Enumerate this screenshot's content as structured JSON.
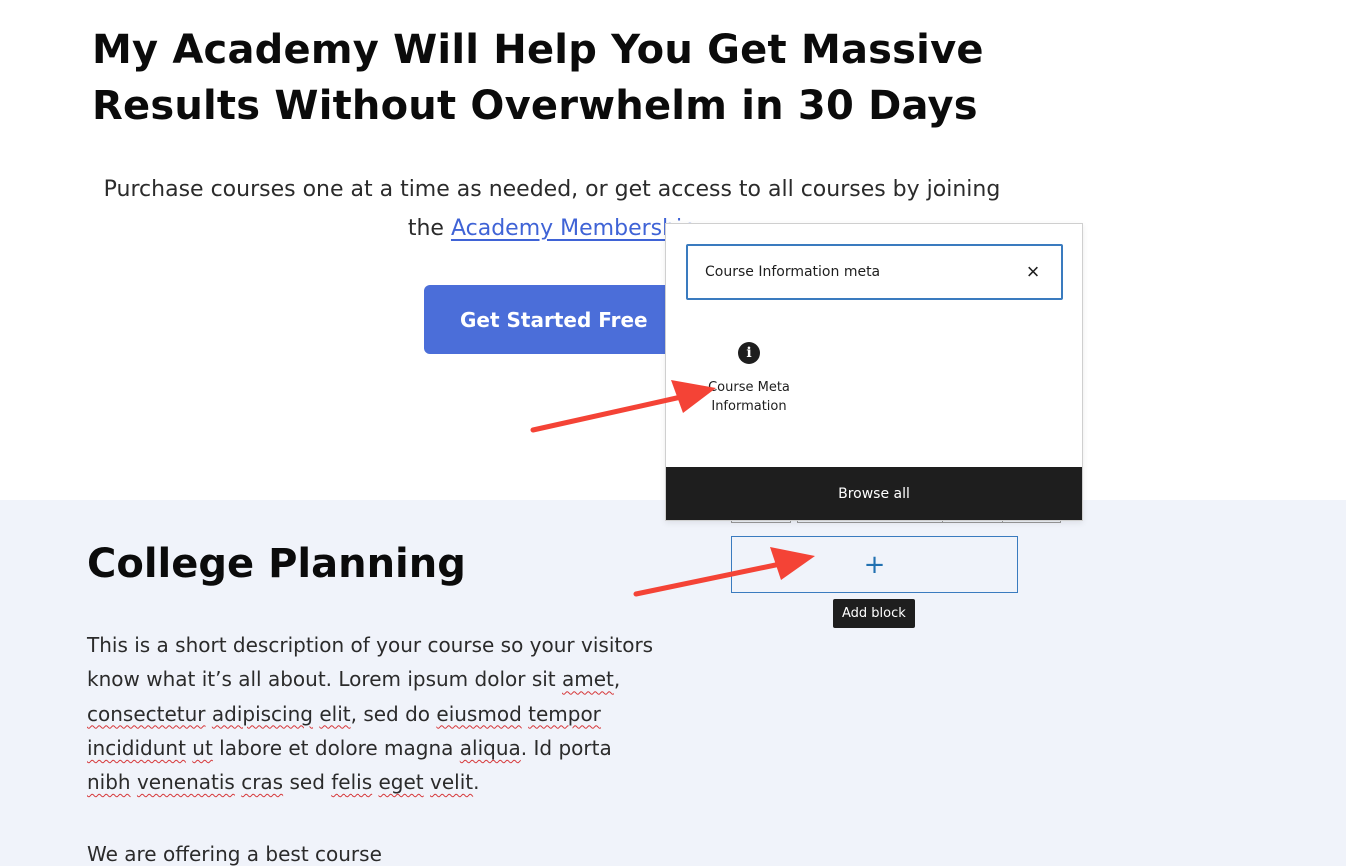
{
  "hero": {
    "title": "My Academy Will Help You Get Massive Results Without Overwhelm in 30 Days",
    "subtitle_prefix": "Purchase courses one at a time as needed, or get access to all courses by joining the ",
    "subtitle_link": "Academy Membership",
    "cta_label": "Get Started Free"
  },
  "course": {
    "title": "College Planning",
    "desc_words": [
      "This is a short description of your course so your visitors know what it’s all about. Lorem ipsum dolor sit ",
      "amet",
      ", ",
      "consectetur",
      " ",
      "adipiscing",
      " ",
      "elit",
      ", sed do ",
      "eiusmod",
      " ",
      "tempor",
      " ",
      "incididunt",
      " ",
      "ut",
      " labore et dolore magna ",
      "aliqua",
      ". Id porta ",
      "nibh",
      " ",
      "venenatis",
      " ",
      "cras",
      " sed ",
      "felis",
      " ",
      "eget",
      " ",
      "velit",
      "."
    ],
    "extra": "We are offering a best course"
  },
  "inserter": {
    "search_value": "Course Information meta",
    "clear_icon": "×",
    "result_icon": "i",
    "result_label": "Course Meta Information",
    "browse_all": "Browse all"
  },
  "add_block": {
    "plus": "+",
    "tooltip": "Add block"
  },
  "colors": {
    "accent": "#4b6ed9",
    "link": "#3f63d6",
    "section_bg": "#f0f3fa",
    "annotation_arrow": "#f44336",
    "editor_blue": "#3a7bbf"
  }
}
